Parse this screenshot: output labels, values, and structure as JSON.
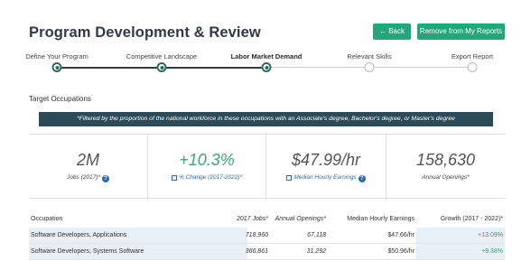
{
  "header": {
    "title": "Program Development & Review",
    "back_label": "← Back",
    "remove_label": "Remove from My Reports"
  },
  "steps": [
    {
      "label": "Define Your Program",
      "state": "done"
    },
    {
      "label": "Competitive Landscape",
      "state": "done"
    },
    {
      "label": "Labor Market Demand",
      "state": "current"
    },
    {
      "label": "Relevant Skills",
      "state": "todo"
    },
    {
      "label": "Export Report",
      "state": "todo"
    }
  ],
  "section": {
    "title": "Target Occupations",
    "banner": "*Filtered by the proportion of the national workforce in these occupations with an Associate's degree, Bachelor's degree, or Master's degree"
  },
  "stats": {
    "jobs": {
      "value": "2M",
      "label": "Jobs (2017)*"
    },
    "change": {
      "value": "+10.3%",
      "label": "% Change (2017-2022)*"
    },
    "earnings": {
      "value": "$47.99/hr",
      "label": "Median Hourly Earnings"
    },
    "openings": {
      "value": "158,630",
      "label": "Annual Openings*"
    }
  },
  "table": {
    "headers": {
      "occupation": "Occupation",
      "jobs": "2017 Jobs*",
      "openings": "Annual Openings*",
      "earnings": "Median Hourly Earnings",
      "growth": "Growth (2017 - 2022)*"
    },
    "rows": [
      {
        "occupation": "Software Developers, Applications",
        "jobs": "718,960",
        "openings": "67,118",
        "earnings": "$47.66/hr",
        "growth": "+13.09%"
      },
      {
        "occupation": "Software Developers, Systems Software",
        "jobs": "366,861",
        "openings": "31,292",
        "earnings": "$50.96/hr",
        "growth": "+9.38%"
      }
    ]
  },
  "colors": {
    "accent": "#25a67a",
    "banner": "#2b4a5a",
    "positive": "#2fa672",
    "link": "#2b6cb0"
  }
}
